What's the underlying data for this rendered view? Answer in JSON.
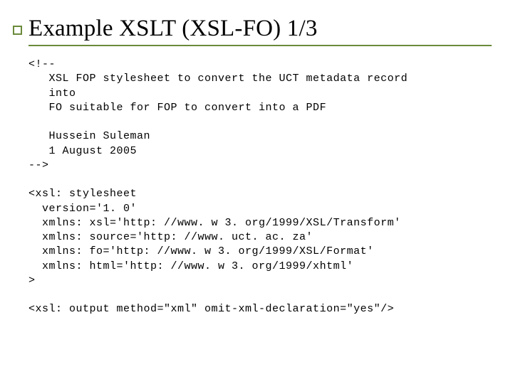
{
  "slide": {
    "title": "Example XSLT (XSL-FO) 1/3",
    "code": "<!--\n   XSL FOP stylesheet to convert the UCT metadata record\n   into\n   FO suitable for FOP to convert into a PDF\n\n   Hussein Suleman\n   1 August 2005\n-->\n\n<xsl: stylesheet\n  version='1. 0'\n  xmlns: xsl='http: //www. w 3. org/1999/XSL/Transform'\n  xmlns: source='http: //www. uct. ac. za'\n  xmlns: fo='http: //www. w 3. org/1999/XSL/Format'\n  xmlns: html='http: //www. w 3. org/1999/xhtml'\n>\n\n<xsl: output method=\"xml\" omit-xml-declaration=\"yes\"/>"
  }
}
